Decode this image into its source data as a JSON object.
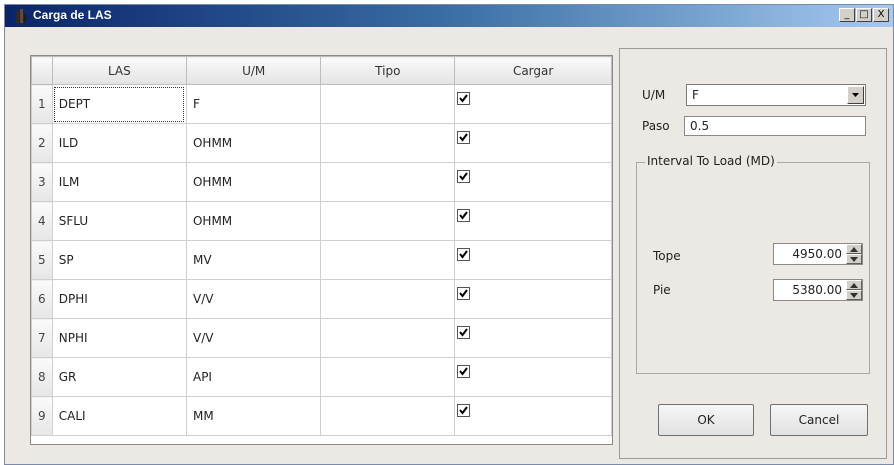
{
  "window": {
    "title": "Carga de LAS",
    "icon": "app-icon",
    "controls": [
      "_",
      "□",
      "X"
    ]
  },
  "table": {
    "columns": [
      "LAS",
      "U/M",
      "Tipo",
      "Cargar"
    ],
    "rows": [
      {
        "n": "1",
        "las": "DEPT",
        "um": "F",
        "tipo": "",
        "cargar": true
      },
      {
        "n": "2",
        "las": "ILD",
        "um": "OHMM",
        "tipo": "",
        "cargar": true
      },
      {
        "n": "3",
        "las": "ILM",
        "um": "OHMM",
        "tipo": "",
        "cargar": true
      },
      {
        "n": "4",
        "las": "SFLU",
        "um": "OHMM",
        "tipo": "",
        "cargar": true
      },
      {
        "n": "5",
        "las": "SP",
        "um": "MV",
        "tipo": "",
        "cargar": true
      },
      {
        "n": "6",
        "las": "DPHI",
        "um": "V/V",
        "tipo": "",
        "cargar": true
      },
      {
        "n": "7",
        "las": "NPHI",
        "um": "V/V",
        "tipo": "",
        "cargar": true
      },
      {
        "n": "8",
        "las": "GR",
        "um": "API",
        "tipo": "",
        "cargar": true
      },
      {
        "n": "9",
        "las": "CALI",
        "um": "MM",
        "tipo": "",
        "cargar": true
      }
    ]
  },
  "panel": {
    "um_label": "U/M",
    "um_value": "F",
    "paso_label": "Paso",
    "paso_value": "0.5",
    "group_title": "Interval To Load (MD)",
    "tope_label": "Tope",
    "tope_value": "4950.00",
    "pie_label": "Pie",
    "pie_value": "5380.00",
    "ok_label": "OK",
    "cancel_label": "Cancel"
  }
}
